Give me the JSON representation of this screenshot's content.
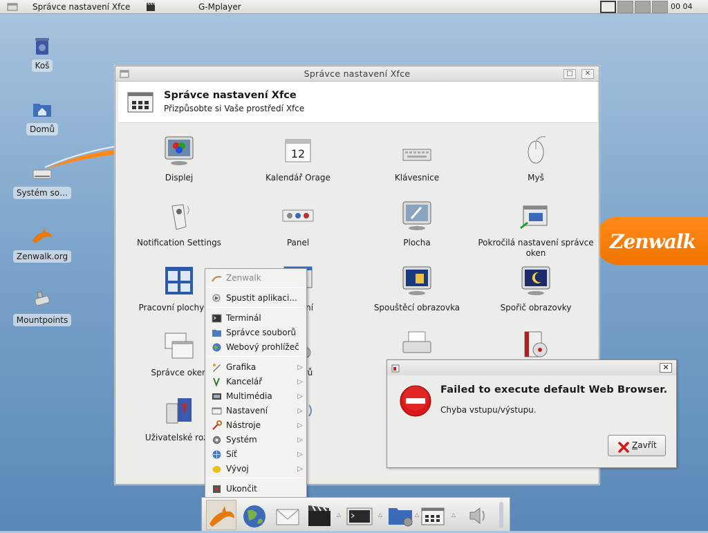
{
  "top_panel": {
    "window_title": "Správce nastavení Xfce",
    "second_task": "G-Mplayer",
    "clock": "00 04",
    "pager_count": 4,
    "pager_active_index": 0
  },
  "desktop": {
    "icons": [
      {
        "label": "Koš",
        "icon": "trash-icon"
      },
      {
        "label": "Domů",
        "icon": "home-folder-icon"
      },
      {
        "label": "Systém so…",
        "icon": "filesystem-drive-icon"
      },
      {
        "label": "Zenwalk.org",
        "icon": "zenwalk-dolphin-icon"
      },
      {
        "label": "Mountpoints",
        "icon": "mountpoints-icon"
      }
    ],
    "banner_text": "Zenwalk"
  },
  "settings_window": {
    "title": "Správce nastavení Xfce",
    "header_title": "Správce nastavení Xfce",
    "header_subtitle": "Přizpůsobte si Vaše prostředí Xfce",
    "items": [
      {
        "label": "Displej",
        "icon": "display-icon"
      },
      {
        "label": "Kalendář Orage",
        "icon": "calendar-icon"
      },
      {
        "label": "Klávesnice",
        "icon": "keyboard-icon"
      },
      {
        "label": "Myš",
        "icon": "mouse-icon"
      },
      {
        "label": "Notification Settings",
        "icon": "notification-icon"
      },
      {
        "label": "Panel",
        "icon": "panel-icon"
      },
      {
        "label": "Plocha",
        "icon": "desktop-icon"
      },
      {
        "label": "Pokročilá nastavení správce oken",
        "icon": "window-manager-tweaks-icon"
      },
      {
        "label": "Pracovní plochy a o",
        "icon": "workspaces-icon"
      },
      {
        "label": "ouštění",
        "icon": "autostart-icon"
      },
      {
        "label": "Spouštěcí obrazovka",
        "icon": "splash-screen-icon"
      },
      {
        "label": "Spořič obrazovky",
        "icon": "screensaver-icon"
      },
      {
        "label": "Správce oken",
        "icon": "window-manager-icon"
      },
      {
        "label": "ouborů",
        "icon": "file-manager-settings-icon"
      },
      {
        "label": "",
        "icon": "printer-icon"
      },
      {
        "label": "",
        "icon": "media-icon"
      },
      {
        "label": "Uživatelské rozh",
        "icon": "user-interface-icon"
      },
      {
        "label": "",
        "icon": "sound-icon"
      }
    ]
  },
  "app_menu": {
    "items": [
      {
        "label": "Zenwalk",
        "icon": "zenwalk-logo-icon",
        "disabled": true,
        "submenu": false
      },
      {
        "label": "Spustit aplikaci...",
        "icon": "run-icon",
        "disabled": false,
        "submenu": false
      },
      {
        "label": "Terminál",
        "icon": "terminal-icon",
        "disabled": false,
        "submenu": false
      },
      {
        "label": "Správce souborů",
        "icon": "file-manager-icon",
        "disabled": false,
        "submenu": false
      },
      {
        "label": "Webový prohlížeč",
        "icon": "web-browser-icon",
        "disabled": false,
        "submenu": false
      },
      {
        "label": "Grafika",
        "icon": "graphics-icon",
        "disabled": false,
        "submenu": true
      },
      {
        "label": "Kancelář",
        "icon": "office-icon",
        "disabled": false,
        "submenu": true
      },
      {
        "label": "Multimédia",
        "icon": "multimedia-icon",
        "disabled": false,
        "submenu": true
      },
      {
        "label": "Nastavení",
        "icon": "settings-icon",
        "disabled": false,
        "submenu": true
      },
      {
        "label": "Nástroje",
        "icon": "tools-icon",
        "disabled": false,
        "submenu": true
      },
      {
        "label": "Systém",
        "icon": "system-icon",
        "disabled": false,
        "submenu": true
      },
      {
        "label": "Síť",
        "icon": "network-icon",
        "disabled": false,
        "submenu": true
      },
      {
        "label": "Vývoj",
        "icon": "development-icon",
        "disabled": false,
        "submenu": true
      },
      {
        "label": "Ukončit",
        "icon": "quit-icon",
        "disabled": false,
        "submenu": false
      }
    ]
  },
  "error_dialog": {
    "title": "Failed to execute default Web Browser.",
    "message": "Chyba vstupu/výstupu.",
    "close_button": "Zavřít",
    "close_button_mnemonic": "Z"
  },
  "bottom_panel": {
    "launchers": [
      "zenwalk-menu-icon",
      "web-browser-globe-icon",
      "mail-icon",
      "media-player-icon",
      "terminal-launcher-icon",
      "file-manager-launcher-icon",
      "settings-manager-launcher-icon",
      "volume-icon"
    ]
  },
  "colors": {
    "accent_orange": "#f07400",
    "error_red": "#d81818",
    "desktop_blue": "#7ea6cc"
  }
}
